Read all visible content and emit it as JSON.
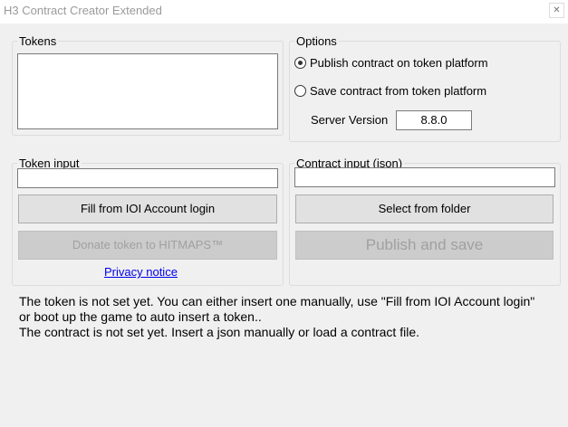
{
  "window": {
    "title": "H3 Contract Creator Extended",
    "close_glyph": "✕"
  },
  "tokens_group": {
    "legend": "Tokens",
    "list_value": ""
  },
  "options_group": {
    "legend": "Options",
    "radio_publish_label": "Publish contract on token platform",
    "radio_save_label": "Save contract from token platform",
    "radio_publish_checked": true,
    "server_version_label": "Server Version",
    "server_version_value": "8.8.0"
  },
  "token_input_group": {
    "legend": "Token input",
    "input_value": "",
    "fill_button_label": "Fill from IOI Account login",
    "donate_button_label": "Donate token to HITMAPS™",
    "privacy_link_label": "Privacy notice"
  },
  "contract_input_group": {
    "legend": "Contract input (json)",
    "input_value": "",
    "select_button_label": "Select from folder",
    "publish_button_label": "Publish and save"
  },
  "status": {
    "line1": "The token is not set yet. You can either insert one manually, use \"Fill from IOI Account login\"",
    "line2": "or boot up the game to auto insert a token..",
    "line3": "The contract is not set yet. Insert a json manually or load a contract file."
  }
}
